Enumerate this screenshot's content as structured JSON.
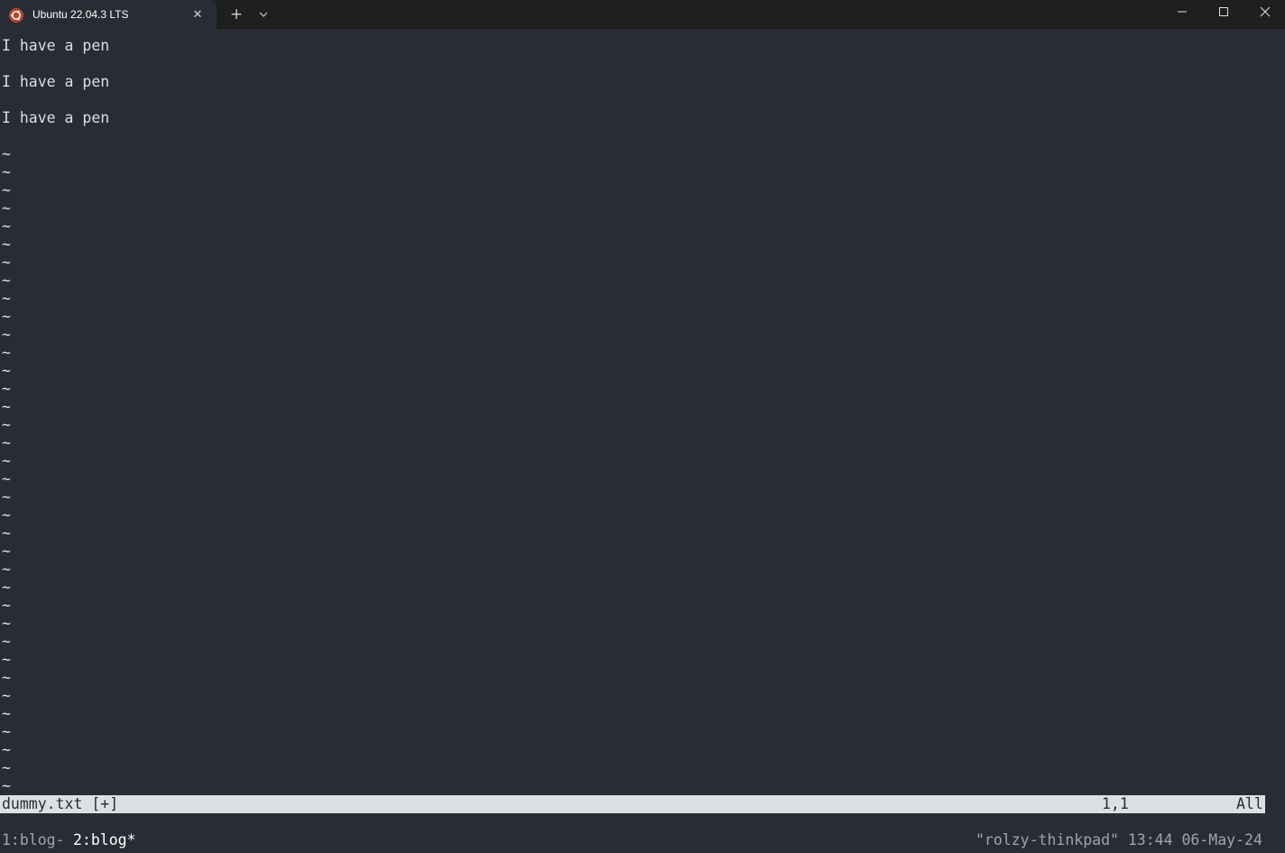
{
  "window": {
    "tab_title": "Ubuntu 22.04.3 LTS",
    "tab_icon": "ubuntu-logo-icon",
    "new_tab_label": "+",
    "close_tab_label": "✕"
  },
  "editor": {
    "lines": [
      {
        "text": "I have a pen"
      },
      {
        "text": ""
      },
      {
        "text": "I have a pen"
      },
      {
        "text": ""
      },
      {
        "text": "I have a pen"
      },
      {
        "text": ""
      }
    ],
    "tilde": "~",
    "tilde_count": 36
  },
  "statusline": {
    "file": "dummy.txt [+]",
    "position": "1,1",
    "percent": "All"
  },
  "tmux": {
    "window1": "1:blog-",
    "window2": "2:blog*",
    "right": "\"rolzy-thinkpad\" 13:44 06-May-24"
  },
  "colors": {
    "background": "#282c34",
    "titlebar": "#1f1f1f",
    "foreground": "#dcdfe4",
    "ubuntu_orange": "#b14a2e"
  }
}
